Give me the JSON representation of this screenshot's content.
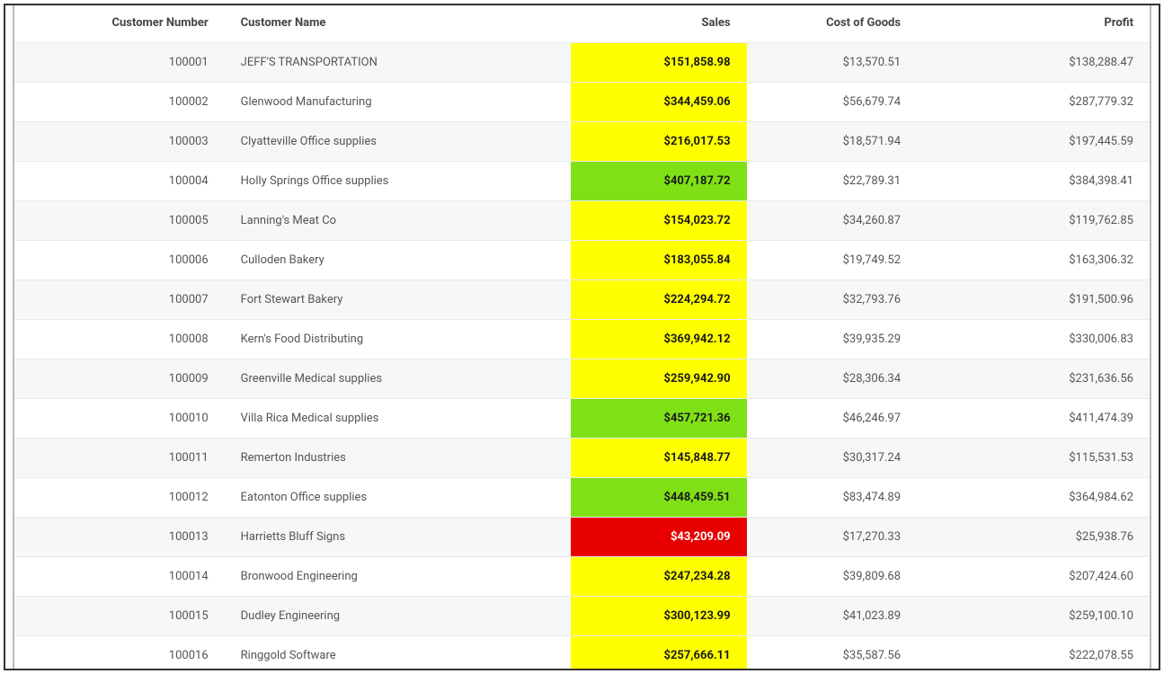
{
  "table": {
    "headers": {
      "customer_number": "Customer Number",
      "customer_name": "Customer Name",
      "sales": "Sales",
      "cost_of_goods": "Cost of Goods",
      "profit": "Profit"
    },
    "rows": [
      {
        "customer_number": "100001",
        "customer_name": "JEFF'S TRANSPORTATION",
        "sales": "$151,858.98",
        "sales_highlight": "yellow",
        "cost": "$13,570.51",
        "profit": "$138,288.47"
      },
      {
        "customer_number": "100002",
        "customer_name": "Glenwood Manufacturing",
        "sales": "$344,459.06",
        "sales_highlight": "yellow",
        "cost": "$56,679.74",
        "profit": "$287,779.32"
      },
      {
        "customer_number": "100003",
        "customer_name": "Clyatteville Office supplies",
        "sales": "$216,017.53",
        "sales_highlight": "yellow",
        "cost": "$18,571.94",
        "profit": "$197,445.59"
      },
      {
        "customer_number": "100004",
        "customer_name": "Holly Springs Office supplies",
        "sales": "$407,187.72",
        "sales_highlight": "green",
        "cost": "$22,789.31",
        "profit": "$384,398.41"
      },
      {
        "customer_number": "100005",
        "customer_name": "Lanning's Meat Co",
        "sales": "$154,023.72",
        "sales_highlight": "yellow",
        "cost": "$34,260.87",
        "profit": "$119,762.85"
      },
      {
        "customer_number": "100006",
        "customer_name": "Culloden Bakery",
        "sales": "$183,055.84",
        "sales_highlight": "yellow",
        "cost": "$19,749.52",
        "profit": "$163,306.32"
      },
      {
        "customer_number": "100007",
        "customer_name": "Fort Stewart Bakery",
        "sales": "$224,294.72",
        "sales_highlight": "yellow",
        "cost": "$32,793.76",
        "profit": "$191,500.96"
      },
      {
        "customer_number": "100008",
        "customer_name": "Kern's Food Distributing",
        "sales": "$369,942.12",
        "sales_highlight": "yellow",
        "cost": "$39,935.29",
        "profit": "$330,006.83"
      },
      {
        "customer_number": "100009",
        "customer_name": "Greenville Medical supplies",
        "sales": "$259,942.90",
        "sales_highlight": "yellow",
        "cost": "$28,306.34",
        "profit": "$231,636.56"
      },
      {
        "customer_number": "100010",
        "customer_name": "Villa Rica Medical supplies",
        "sales": "$457,721.36",
        "sales_highlight": "green",
        "cost": "$46,246.97",
        "profit": "$411,474.39"
      },
      {
        "customer_number": "100011",
        "customer_name": "Remerton Industries",
        "sales": "$145,848.77",
        "sales_highlight": "yellow",
        "cost": "$30,317.24",
        "profit": "$115,531.53"
      },
      {
        "customer_number": "100012",
        "customer_name": "Eatonton Office supplies",
        "sales": "$448,459.51",
        "sales_highlight": "green",
        "cost": "$83,474.89",
        "profit": "$364,984.62"
      },
      {
        "customer_number": "100013",
        "customer_name": "Harrietts Bluff Signs",
        "sales": "$43,209.09",
        "sales_highlight": "red",
        "cost": "$17,270.33",
        "profit": "$25,938.76"
      },
      {
        "customer_number": "100014",
        "customer_name": "Bronwood Engineering",
        "sales": "$247,234.28",
        "sales_highlight": "yellow",
        "cost": "$39,809.68",
        "profit": "$207,424.60"
      },
      {
        "customer_number": "100015",
        "customer_name": "Dudley Engineering",
        "sales": "$300,123.99",
        "sales_highlight": "yellow",
        "cost": "$41,023.89",
        "profit": "$259,100.10"
      },
      {
        "customer_number": "100016",
        "customer_name": "Ringgold Software",
        "sales": "$257,666.11",
        "sales_highlight": "yellow",
        "cost": "$35,587.56",
        "profit": "$222,078.55"
      }
    ]
  }
}
